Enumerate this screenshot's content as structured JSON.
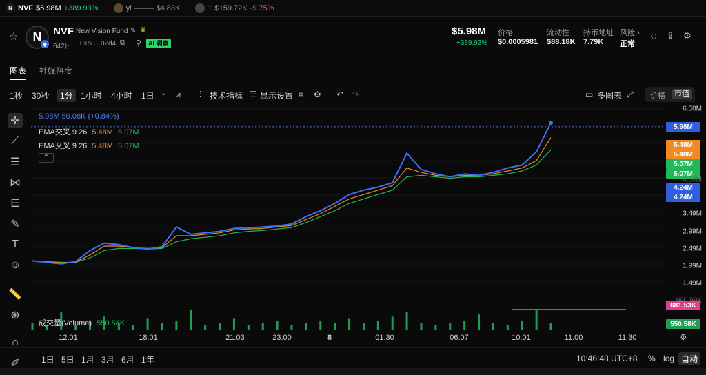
{
  "ticker": [
    {
      "logo": "N",
      "name": "NVF",
      "value": "$5.98M",
      "change": "+389.93%",
      "change_dir": "up"
    },
    {
      "logo": "",
      "name": "yi",
      "value": "$4.83K",
      "change": "",
      "change_dir": ""
    },
    {
      "logo": "",
      "name": "1",
      "value": "$159.72K",
      "change": "-9.75%",
      "change_dir": "down"
    }
  ],
  "token": {
    "avatar_letter": "N",
    "symbol": "NVF",
    "name": "New Vision Fund",
    "age": "642日",
    "address": "0xb8...02d4",
    "ai_label": "AI 洞察",
    "price": "$5.98M",
    "change": "+389.93%"
  },
  "stats": [
    {
      "label": "价格",
      "value": "$0.0005981"
    },
    {
      "label": "流动性",
      "value": "$88.18K"
    },
    {
      "label": "持币地址",
      "value": "7.79K"
    },
    {
      "label": "风险 ›",
      "value": "正常"
    }
  ],
  "tabs": [
    "图表",
    "社媒热度"
  ],
  "toolbar": {
    "intervals": [
      "1秒",
      "30秒",
      "1分",
      "1小时",
      "4小时",
      "1日"
    ],
    "active_interval": "1分",
    "indicators": "技术指标",
    "display": "显示设置",
    "multi": "多图表",
    "seg_price": "价格",
    "seg_mcap": "市值"
  },
  "legend": {
    "price_line": "5.98M  50.08K (+0.84%)",
    "ema1_label": "EMA交叉 9 26",
    "ema1_a": "5.48M",
    "ema1_b": "5.07M",
    "ema2_label": "EMA交叉 9 26",
    "ema2_a": "5.48M",
    "ema2_b": "5.07M",
    "volume_label": "成交量(Volume)",
    "volume_value": "550.58K"
  },
  "y_ticks": [
    "6.50M",
    "5.98M",
    "5.48M",
    "5.48M",
    "5.07M",
    "5.07M",
    "4.50M",
    "4.24M",
    "4.24M",
    "3.49M",
    "2.99M",
    "2.49M",
    "1.99M",
    "1.49M",
    "990.99K",
    "681.53K",
    "550.58K"
  ],
  "x_ticks": [
    "12:01",
    "18:01",
    "21:03",
    "23:00",
    "8",
    "01:30",
    "06:07",
    "10:01",
    "11:00",
    "11:30"
  ],
  "bottom": {
    "ranges": [
      "1日",
      "5日",
      "1月",
      "3月",
      "6月",
      "1年"
    ],
    "time": "10:46:48 UTC+8",
    "pct": "%",
    "log": "log",
    "auto": "自动"
  },
  "colors": {
    "price": "#3b6ff5",
    "ema_fast": "#f08a24",
    "ema_slow": "#22b85a",
    "volume": "#1e9e52",
    "up": "#20d07a",
    "down": "#ff4d6d"
  },
  "chart_data": {
    "type": "line",
    "ylim": [
      0,
      6500000
    ],
    "series": [
      {
        "name": "",
        "values": [
          1300000,
          1250000,
          1200000,
          1280000,
          1650000,
          1900000,
          1850000,
          1750000,
          1700000,
          1780000,
          2450000,
          2200000,
          2250000,
          2300000,
          2400000,
          2420000,
          2450000,
          2480000,
          2550000,
          2800000,
          3000000,
          3250000,
          3550000,
          3700000,
          3800000,
          3950000,
          4950000,
          4400000,
          4250000,
          4150000,
          4250000,
          4200000,
          4300000,
          4450000,
          4550000,
          5000000,
          5980000
        ]
      },
      {
        "name": "",
        "values": [
          1300000,
          1270000,
          1230000,
          1260000,
          1500000,
          1800000,
          1800000,
          1750000,
          1720000,
          1750000,
          2150000,
          2150000,
          2200000,
          2250000,
          2350000,
          2380000,
          2400000,
          2450000,
          2500000,
          2700000,
          2900000,
          3150000,
          3400000,
          3550000,
          3700000,
          3850000,
          4450000,
          4300000,
          4200000,
          4150000,
          4200000,
          4200000,
          4250000,
          4350000,
          4450000,
          4700000,
          5480000
        ]
      },
      {
        "name": "",
        "values": [
          1300000,
          1280000,
          1250000,
          1250000,
          1400000,
          1650000,
          1720000,
          1720000,
          1700000,
          1720000,
          1950000,
          2050000,
          2100000,
          2150000,
          2250000,
          2300000,
          2330000,
          2380000,
          2430000,
          2600000,
          2800000,
          3000000,
          3250000,
          3400000,
          3550000,
          3700000,
          4150000,
          4200000,
          4150000,
          4100000,
          4150000,
          4150000,
          4200000,
          4250000,
          4350000,
          4550000,
          5070000
        ]
      }
    ],
    "volume": [
      3,
      2,
      8,
      2,
      4,
      6,
      3,
      2,
      5,
      3,
      4,
      9,
      2,
      3,
      5,
      2,
      3,
      4,
      2,
      3,
      4,
      3,
      5,
      3,
      4,
      6,
      8,
      3,
      2,
      3,
      4,
      7,
      3,
      2,
      4,
      9,
      3
    ]
  }
}
